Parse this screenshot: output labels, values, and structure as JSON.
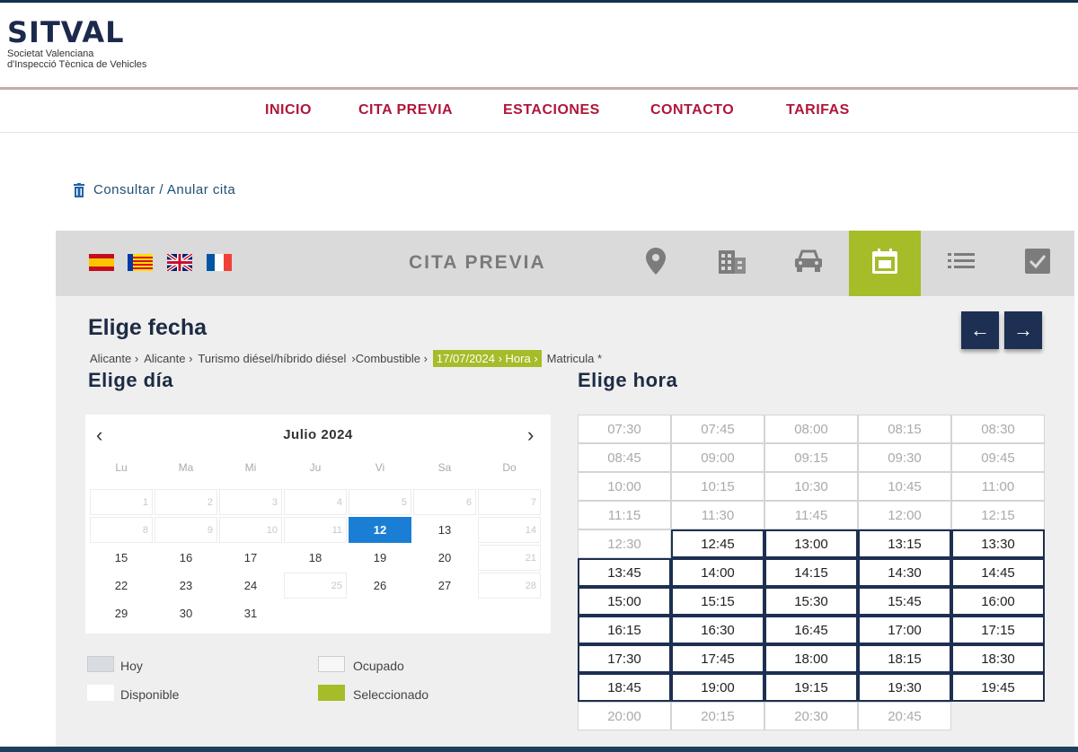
{
  "brand": {
    "name": "SITVAL",
    "subtitle_line1": "Societat Valenciana",
    "subtitle_line2": "d'Inspecció Tècnica de Vehicles"
  },
  "nav": {
    "items": [
      {
        "label": "INICIO"
      },
      {
        "label": "CITA PREVIA"
      },
      {
        "label": "ESTACIONES"
      },
      {
        "label": "CONTACTO"
      },
      {
        "label": "TARIFAS"
      }
    ]
  },
  "consult_link": "Consultar / Anular cita",
  "booking_bar": {
    "title": "CITA PREVIA",
    "flags": [
      "es-flag-icon",
      "valencia-flag-icon",
      "uk-flag-icon",
      "fr-flag-icon"
    ],
    "steps": [
      {
        "icon": "location-pin-icon"
      },
      {
        "icon": "building-icon"
      },
      {
        "icon": "car-icon"
      },
      {
        "icon": "calendar-icon",
        "active": true
      },
      {
        "icon": "list-icon"
      },
      {
        "icon": "checkbox-icon"
      }
    ],
    "accent_color": "#a6bc28"
  },
  "heading": "Elige fecha",
  "arrows": {
    "prev": "←",
    "next": "→"
  },
  "breadcrumb": {
    "items": [
      "Alicante ›",
      "Alicante ›",
      "Turismo diésel/híbrido diésel",
      "›Combustible ›"
    ],
    "highlight": "17/07/2024 › Hora ›",
    "tail": "Matricula *"
  },
  "day_heading": "Elige día",
  "hour_heading": "Elige hora",
  "calendar": {
    "month": "Julio 2024",
    "prev": "‹",
    "next": "›",
    "weekdays": [
      "Lu",
      "Ma",
      "Mi",
      "Ju",
      "Vi",
      "Sa",
      "Do"
    ],
    "weeks": [
      [
        {
          "d": "1",
          "s": "disabled"
        },
        {
          "d": "2",
          "s": "disabled"
        },
        {
          "d": "3",
          "s": "disabled"
        },
        {
          "d": "4",
          "s": "disabled"
        },
        {
          "d": "5",
          "s": "disabled"
        },
        {
          "d": "6",
          "s": "disabled"
        },
        {
          "d": "7",
          "s": "disabled"
        }
      ],
      [
        {
          "d": "8",
          "s": "disabled"
        },
        {
          "d": "9",
          "s": "disabled"
        },
        {
          "d": "10",
          "s": "disabled"
        },
        {
          "d": "11",
          "s": "disabled"
        },
        {
          "d": "12",
          "s": "selected"
        },
        {
          "d": "13",
          "s": "avail"
        },
        {
          "d": "14",
          "s": "disabled"
        }
      ],
      [
        {
          "d": "15",
          "s": "avail"
        },
        {
          "d": "16",
          "s": "avail"
        },
        {
          "d": "17",
          "s": "avail"
        },
        {
          "d": "18",
          "s": "avail"
        },
        {
          "d": "19",
          "s": "avail"
        },
        {
          "d": "20",
          "s": "avail"
        },
        {
          "d": "21",
          "s": "disabled"
        }
      ],
      [
        {
          "d": "22",
          "s": "avail"
        },
        {
          "d": "23",
          "s": "avail"
        },
        {
          "d": "24",
          "s": "avail"
        },
        {
          "d": "25",
          "s": "disabled"
        },
        {
          "d": "26",
          "s": "avail"
        },
        {
          "d": "27",
          "s": "avail"
        },
        {
          "d": "28",
          "s": "disabled"
        }
      ],
      [
        {
          "d": "29",
          "s": "avail"
        },
        {
          "d": "30",
          "s": "avail"
        },
        {
          "d": "31",
          "s": "avail"
        }
      ]
    ]
  },
  "legend": {
    "today": "Hoy",
    "busy": "Ocupado",
    "available": "Disponible",
    "selected": "Seleccionado",
    "today_color": "#d8dde3",
    "selected_color": "#a6bc28"
  },
  "times": [
    {
      "t": "07:30",
      "a": false
    },
    {
      "t": "07:45",
      "a": false
    },
    {
      "t": "08:00",
      "a": false
    },
    {
      "t": "08:15",
      "a": false
    },
    {
      "t": "08:30",
      "a": false
    },
    {
      "t": "08:45",
      "a": false
    },
    {
      "t": "09:00",
      "a": false
    },
    {
      "t": "09:15",
      "a": false
    },
    {
      "t": "09:30",
      "a": false
    },
    {
      "t": "09:45",
      "a": false
    },
    {
      "t": "10:00",
      "a": false
    },
    {
      "t": "10:15",
      "a": false
    },
    {
      "t": "10:30",
      "a": false
    },
    {
      "t": "10:45",
      "a": false
    },
    {
      "t": "11:00",
      "a": false
    },
    {
      "t": "11:15",
      "a": false
    },
    {
      "t": "11:30",
      "a": false
    },
    {
      "t": "11:45",
      "a": false
    },
    {
      "t": "12:00",
      "a": false
    },
    {
      "t": "12:15",
      "a": false
    },
    {
      "t": "12:30",
      "a": false
    },
    {
      "t": "12:45",
      "a": true
    },
    {
      "t": "13:00",
      "a": true
    },
    {
      "t": "13:15",
      "a": true
    },
    {
      "t": "13:30",
      "a": true
    },
    {
      "t": "13:45",
      "a": true
    },
    {
      "t": "14:00",
      "a": true
    },
    {
      "t": "14:15",
      "a": true
    },
    {
      "t": "14:30",
      "a": true
    },
    {
      "t": "14:45",
      "a": true
    },
    {
      "t": "15:00",
      "a": true
    },
    {
      "t": "15:15",
      "a": true
    },
    {
      "t": "15:30",
      "a": true
    },
    {
      "t": "15:45",
      "a": true
    },
    {
      "t": "16:00",
      "a": true
    },
    {
      "t": "16:15",
      "a": true
    },
    {
      "t": "16:30",
      "a": true
    },
    {
      "t": "16:45",
      "a": true
    },
    {
      "t": "17:00",
      "a": true
    },
    {
      "t": "17:15",
      "a": true
    },
    {
      "t": "17:30",
      "a": true
    },
    {
      "t": "17:45",
      "a": true
    },
    {
      "t": "18:00",
      "a": true
    },
    {
      "t": "18:15",
      "a": true
    },
    {
      "t": "18:30",
      "a": true
    },
    {
      "t": "18:45",
      "a": true
    },
    {
      "t": "19:00",
      "a": true
    },
    {
      "t": "19:15",
      "a": true
    },
    {
      "t": "19:30",
      "a": true
    },
    {
      "t": "19:45",
      "a": true
    },
    {
      "t": "20:00",
      "a": false
    },
    {
      "t": "20:15",
      "a": false
    },
    {
      "t": "20:30",
      "a": false
    },
    {
      "t": "20:45",
      "a": false
    }
  ]
}
